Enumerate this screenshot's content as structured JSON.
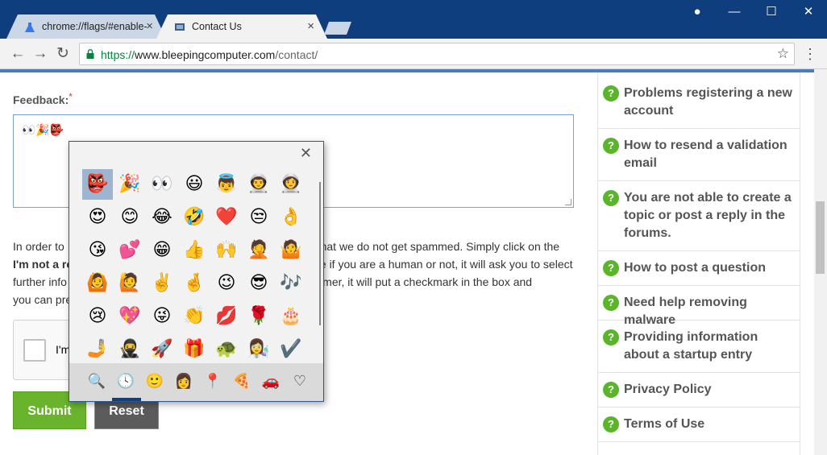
{
  "browser": {
    "tabs": [
      {
        "label": "chrome://flags/#enable-(",
        "close": "×"
      },
      {
        "label": "Contact Us",
        "close": "×"
      }
    ],
    "window_controls": {
      "account": "●",
      "minimize": "—",
      "maximize": "☐",
      "close": "✕"
    },
    "nav": {
      "back": "←",
      "forward": "→",
      "reload": "↻",
      "menu": "⋮",
      "bookmark": "☆"
    },
    "url": {
      "scheme": "https://",
      "host": "www.bleepingcomputer.com",
      "path": "/contact/"
    }
  },
  "form": {
    "feedback_label": "Feedback:",
    "required_mark": "*",
    "feedback_value": "👀🎉👺",
    "paragraph_start": "In order to",
    "paragraph_middle": " that we do not get spammed. Simply click on the",
    "robot_bold": "I'm not a ro",
    "paragraph_line2": "e if you are a human or not, it will ask you to select",
    "paragraph_line3a": "further info",
    "paragraph_line3b": "pammer, it will put a checkmark in the box and",
    "paragraph_line4": "you can pre",
    "captcha_label": "I'm",
    "submit_label": "Submit",
    "reset_label": "Reset"
  },
  "sidebar": {
    "qmark": "?",
    "items": [
      {
        "label": "Problems registering a new account"
      },
      {
        "label": "How to resend a validation email"
      },
      {
        "label": "You are not able to create a topic or post a reply in the forums."
      },
      {
        "label": "How to post a question"
      },
      {
        "label": "Need help removing malware"
      },
      {
        "label": "Providing information about a startup entry"
      },
      {
        "label": "Privacy Policy"
      },
      {
        "label": "Terms of Use"
      }
    ]
  },
  "emoji_picker": {
    "close": "✕",
    "rows": [
      [
        "👺",
        "🎉",
        "👀",
        "😃",
        "👼",
        "👨‍🚀",
        "👩‍🚀"
      ],
      [
        "😍",
        "😊",
        "😂",
        "🤣",
        "❤️",
        "😒",
        "👌"
      ],
      [
        "😘",
        "💕",
        "😁",
        "👍",
        "🙌",
        "🤦",
        "🤷"
      ],
      [
        "🙆",
        "🙋",
        "✌️",
        "🤞",
        "😉",
        "😎",
        "🎶"
      ],
      [
        "😢",
        "💖",
        "😜",
        "👏",
        "💋",
        "🌹",
        "🎂"
      ],
      [
        "🤳",
        "🥷",
        "🚀",
        "🎁",
        "🐢",
        "👩‍🔬",
        "✔️"
      ]
    ],
    "categories": [
      "🔍",
      "🕓",
      "🙂",
      "👩",
      "📍",
      "🍕",
      "🚗",
      "♡"
    ]
  },
  "colors": {
    "titlebar": "#0e3e7e",
    "accent_green": "#6ab42d",
    "reset_gray": "#5b5b5b",
    "picker_selected": "#9eb5d0"
  }
}
